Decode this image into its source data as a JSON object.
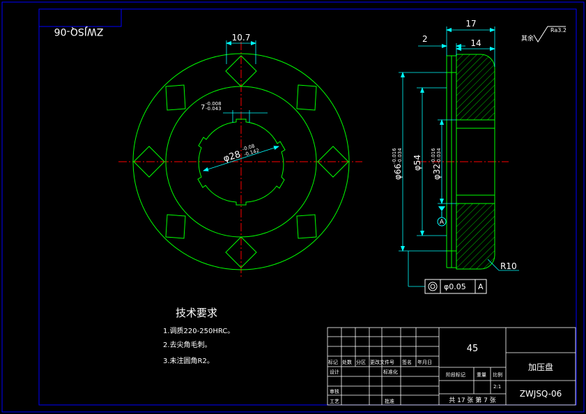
{
  "stamp_code": "ZWJSQ-06",
  "front_view": {
    "key_width": "10.7",
    "spline_width": "7",
    "spline_tol_upper": "-0.008",
    "spline_tol_lower": "-0.043",
    "spline_diameter": "φ28",
    "spline_diam_tol_upper": "-0.08",
    "spline_diam_tol_lower": "-0.142"
  },
  "section_view": {
    "dim_total_width": "17",
    "dim_flange": "2",
    "dim_body": "14",
    "dia_outer": "φ66",
    "dia_outer_tol_upper": "-0.016",
    "dia_outer_tol_lower": "-0.034",
    "dia_mid": "φ54",
    "dia_bore": "φ32",
    "dia_bore_tol_upper": "-0.016",
    "dia_bore_tol_lower": "-0.034",
    "radius": "R10",
    "datum": "A",
    "roughness_label": "其余",
    "roughness_value": "Ra3.2",
    "tolerance_frame": {
      "symbol": "◎",
      "value": "φ0.05",
      "datum": "A"
    }
  },
  "tech_requirements": {
    "title": "技术要求",
    "items": [
      "1.调质220-250HRC。",
      "2.去尖角毛刺。",
      "3.未注圆角R2。"
    ]
  },
  "title_block": {
    "material": "45",
    "part_name": "加压盘",
    "drawing_number": "ZWJSQ-06",
    "scale": "2:1",
    "sheet_info": "共 17 张  第 7 张",
    "headers": [
      "标记",
      "处数",
      "分区",
      "更改文件号",
      "签名",
      "年月日"
    ],
    "row_labels": [
      "设计",
      "标准化",
      "审核",
      "工艺",
      "批准"
    ],
    "mid_headers": [
      "阶段标记",
      "重量",
      "比例"
    ]
  },
  "colors": {
    "frame": "#0000ff",
    "part_outline": "#00ff00",
    "centerline": "#ff0000",
    "dimension": "#00ffff",
    "text": "#ffffff"
  }
}
